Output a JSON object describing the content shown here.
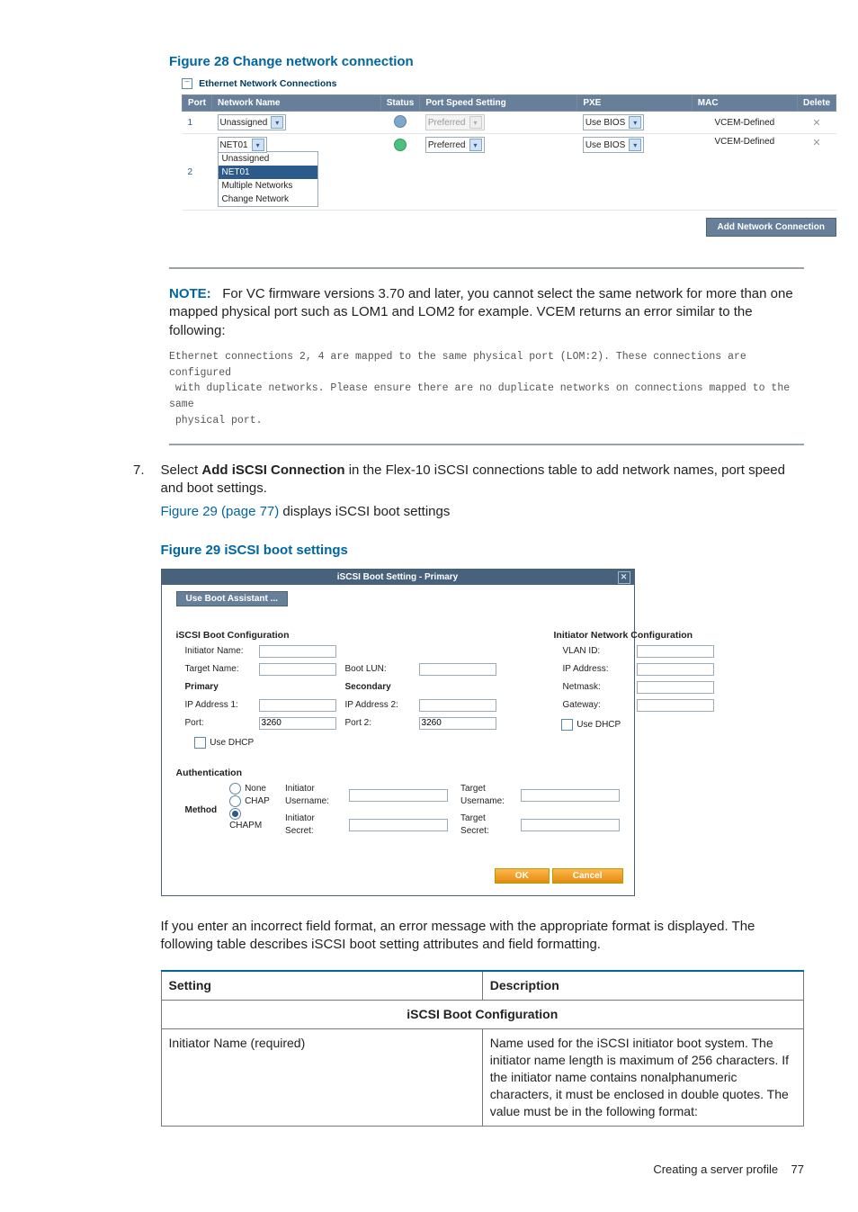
{
  "figure28": {
    "title": "Figure 28 Change network connection",
    "section_label": "Ethernet Network Connections",
    "headers": [
      "Port",
      "Network Name",
      "Status",
      "Port Speed Setting",
      "PXE",
      "MAC",
      "Delete"
    ],
    "rows": [
      {
        "port": "1",
        "net": "Unassigned",
        "status": "unknown",
        "speed": "Preferred",
        "speed_disabled": true,
        "pxe": "Use BIOS",
        "mac": "VCEM-Defined"
      },
      {
        "port": "2",
        "net": "NET01",
        "status": "ok",
        "speed": "Preferred",
        "speed_disabled": false,
        "pxe": "Use BIOS",
        "mac": "VCEM-Defined"
      }
    ],
    "dropdown": [
      "Unassigned",
      "NET01",
      "Multiple Networks",
      "Change Network"
    ],
    "dropdown_highlight": "NET01",
    "add_button": "Add Network Connection"
  },
  "note": {
    "label": "NOTE:",
    "text": "For VC firmware versions 3.70 and later, you cannot select the same network for more than one mapped physical port such as LOM1 and LOM2 for example. VCEM returns an error similar to the following:",
    "code": "Ethernet connections 2, 4 are mapped to the same physical port (LOM:2). These connections are configured\n with duplicate networks. Please ensure there are no duplicate networks on connections mapped to the same\n physical port."
  },
  "step7": {
    "num": "7.",
    "pre": "Select ",
    "bold": "Add iSCSI Connection",
    "post": " in the Flex-10 iSCSI connections table to add network names, port speed and boot settings.",
    "link": "Figure 29 (page 77)",
    "link_post": " displays iSCSI boot settings"
  },
  "figure29": {
    "title_fig": "Figure 29 iSCSI boot settings",
    "dialog_title": "iSCSI Boot Setting - Primary",
    "boot_assistant": "Use Boot Assistant ...",
    "sect_boot": "iSCSI Boot Configuration",
    "sect_net": "Initiator Network Configuration",
    "labels": {
      "initiator_name": "Initiator Name:",
      "target_name": "Target Name:",
      "primary": "Primary",
      "secondary": "Secondary",
      "boot_lun": "Boot LUN:",
      "ip1": "IP Address 1:",
      "ip2": "IP Address 2:",
      "port": "Port:",
      "port2": "Port 2:",
      "use_dhcp": "Use DHCP",
      "vlan": "VLAN ID:",
      "ipaddr": "IP Address:",
      "netmask": "Netmask:",
      "gateway": "Gateway:"
    },
    "values": {
      "port": "3260",
      "port2": "3260"
    },
    "auth": {
      "heading": "Authentication",
      "method_label": "Method",
      "options": [
        "None",
        "CHAP",
        "CHAPM"
      ],
      "selected": "CHAPM",
      "init_user": "Initiator Username:",
      "init_secret": "Initiator Secret:",
      "tgt_user": "Target Username:",
      "tgt_secret": "Target Secret:"
    },
    "ok": "OK",
    "cancel": "Cancel"
  },
  "para_after": "If you enter an incorrect field format, an error message with the appropriate format is displayed. The following table describes iSCSI boot setting attributes and field formatting.",
  "spec_table": {
    "h1": "Setting",
    "h2": "Description",
    "section": "iSCSI Boot Configuration",
    "row1_setting": "Initiator Name (required)",
    "row1_desc": "Name used for the iSCSI initiator boot system. The initiator name length is maximum of 256 characters. If the initiator name contains nonalphanumeric characters, it must be enclosed in double quotes. The value must be in the following format:"
  },
  "footer": {
    "text": "Creating a server profile",
    "page": "77"
  }
}
